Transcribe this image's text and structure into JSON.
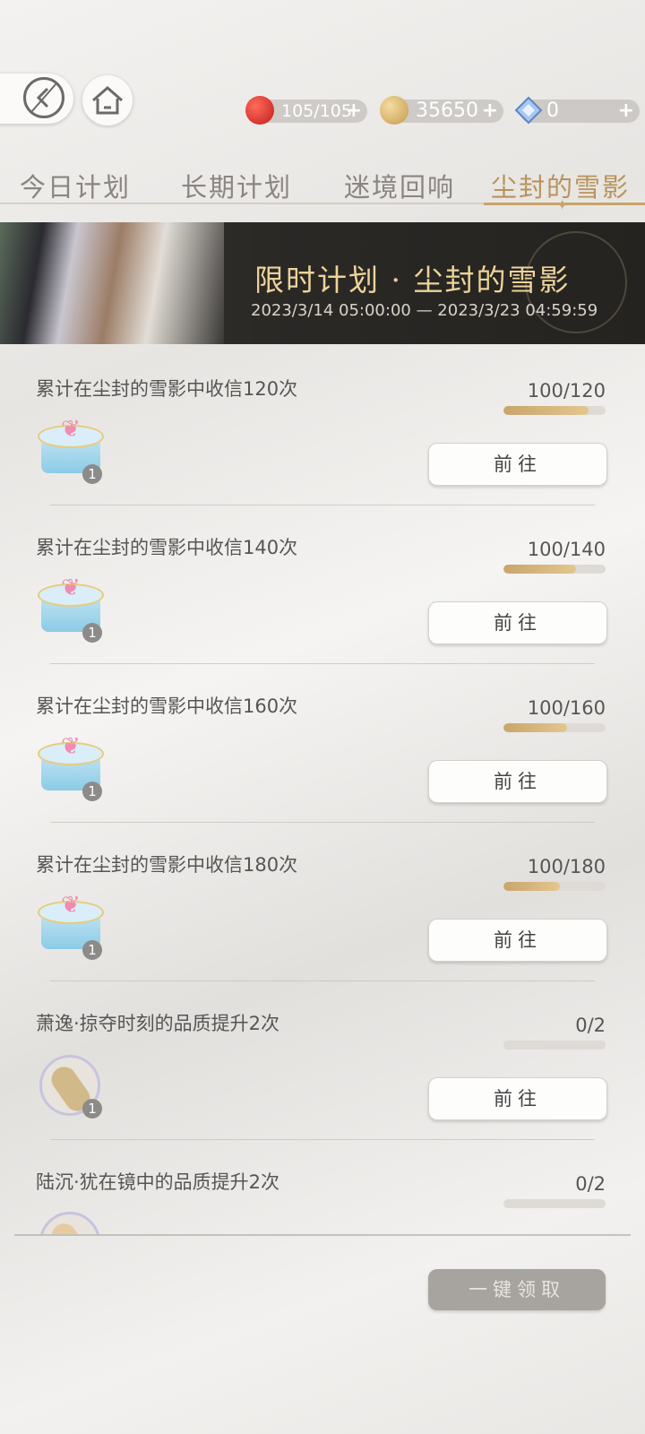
{
  "resources": {
    "stamina": {
      "value": "105/105",
      "icon": "red-apple-icon",
      "color": "#d9322b"
    },
    "gold": {
      "value": "35650",
      "icon": "gold-coin-icon",
      "color": "#d8b060"
    },
    "diamond": {
      "value": "0",
      "icon": "blue-diamond-icon",
      "color": "#6a9fd8"
    },
    "plus_label": "+"
  },
  "tabs": [
    {
      "label": "今日计划",
      "active": false
    },
    {
      "label": "长期计划",
      "active": false
    },
    {
      "label": "迷境回响",
      "active": false
    },
    {
      "label": "尘封的雪影",
      "active": true
    }
  ],
  "banner": {
    "title": "限时计划 · 尘封的雪影",
    "date_range": "2023/3/14 05:00:00 — 2023/3/23 04:59:59"
  },
  "tasks": [
    {
      "title": "累计在尘封的雪影中收信120次",
      "progress": "100/120",
      "fraction": 0.833,
      "reward": "gift-box-icon",
      "count": "1",
      "button": "前往"
    },
    {
      "title": "累计在尘封的雪影中收信140次",
      "progress": "100/140",
      "fraction": 0.714,
      "reward": "gift-box-icon",
      "count": "1",
      "button": "前往"
    },
    {
      "title": "累计在尘封的雪影中收信160次",
      "progress": "100/160",
      "fraction": 0.625,
      "reward": "gift-box-icon",
      "count": "1",
      "button": "前往"
    },
    {
      "title": "累计在尘封的雪影中收信180次",
      "progress": "100/180",
      "fraction": 0.556,
      "reward": "gift-box-icon",
      "count": "1",
      "button": "前往"
    },
    {
      "title": "萧逸·掠夺时刻的品质提升2次",
      "progress": "0/2",
      "fraction": 0,
      "reward": "design-tag-icon",
      "count": "1",
      "button": "前往"
    },
    {
      "title": "陆沉·犹在镜中的品质提升2次",
      "progress": "0/2",
      "fraction": 0,
      "reward": "design-tag-icon",
      "count": "",
      "button": ""
    }
  ],
  "claim_all": "一键领取"
}
